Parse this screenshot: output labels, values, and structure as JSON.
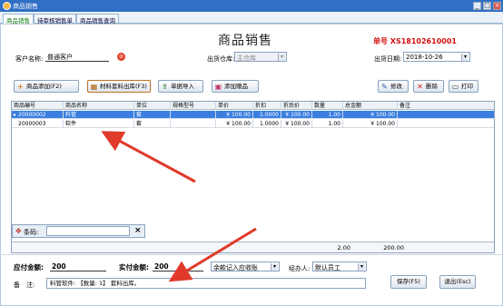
{
  "window": {
    "title": "商品销售",
    "min_glyph": "_",
    "max_glyph": "□",
    "close_glyph": "×"
  },
  "tabs": [
    {
      "label": "商品销售"
    },
    {
      "label": "待审核销售单"
    },
    {
      "label": "商品销售查询"
    }
  ],
  "page_title": "商品销售",
  "order_no": {
    "label": "单号",
    "value": "XS18102610001"
  },
  "form": {
    "customer_label": "客户名称:",
    "customer_value": "普通客户",
    "warehouse_label": "出货仓库:",
    "warehouse_value": "主仓库",
    "date_label": "出货日期:",
    "date_value": "2018-10-26"
  },
  "toolbar": {
    "add_product": "商品添加(F2)",
    "material_out": "材料套料出库(F3)",
    "import": "单据导入",
    "add_gift": "添加赠品",
    "edit": "修改",
    "delete": "删除",
    "print": "打印"
  },
  "icons": {
    "add": "+",
    "material": "▦",
    "import": "⇪",
    "gift": "▣",
    "edit": "✎",
    "delete": "✕",
    "print": "▭",
    "customer_lookup": "⊘",
    "barcode": "✥",
    "barcode_clear": "×",
    "dropdown": "▾"
  },
  "table": {
    "columns": [
      "商品编号",
      "商品名称",
      "单位",
      "规格型号",
      "单价",
      "折扣",
      "折后价",
      "数量",
      "总金额",
      "备注"
    ],
    "rows": [
      {
        "marker": "▸",
        "code": "20000002",
        "name": "料管",
        "unit": "套",
        "spec": "",
        "price": "¥ 100.00",
        "discount": "1.0000",
        "disc_price": "¥ 100.00",
        "qty": "1.00",
        "total": "¥ 100.00",
        "remark": ""
      },
      {
        "marker": "",
        "code": "20000003",
        "name": "软件",
        "unit": "套",
        "spec": "",
        "price": "¥ 100.00",
        "discount": "1.0000",
        "disc_price": "¥ 100.00",
        "qty": "1.00",
        "total": "¥ 100.00",
        "remark": ""
      }
    ],
    "footer": {
      "qty_total": "2.00",
      "amount_total": "200.00"
    }
  },
  "barcode": {
    "label": "条码:",
    "value": ""
  },
  "amounts": {
    "payable_label": "应付金额:",
    "payable_value": "200",
    "paid_label": "实付金额:",
    "paid_value": "200",
    "method_value": "余款记入应收账",
    "handler_label": "经办人:",
    "handler_value": "默认员工"
  },
  "remark": {
    "label": "备　注:",
    "value": "料管软件: 【数量: 1】 套料出库。"
  },
  "actions": {
    "save": "保存(F5)",
    "exit": "退出(Esc)"
  },
  "colors": {
    "title_bar": "#2f6fc4",
    "order_no": "#d01010",
    "selected_row": "#3a7ee0",
    "arrow": "#e03a2a"
  }
}
